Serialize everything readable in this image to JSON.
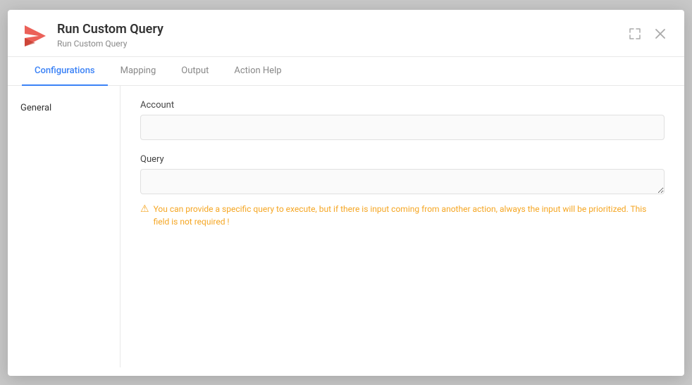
{
  "modal": {
    "title": "Run Custom Query",
    "subtitle": "Run Custom Query",
    "tabs": [
      {
        "label": "Configurations",
        "active": true
      },
      {
        "label": "Mapping",
        "active": false
      },
      {
        "label": "Output",
        "active": false
      },
      {
        "label": "Action Help",
        "active": false
      }
    ],
    "sidebar": {
      "items": [
        {
          "label": "General"
        }
      ]
    },
    "fields": {
      "account": {
        "label": "Account",
        "placeholder": "",
        "value": ""
      },
      "query": {
        "label": "Query",
        "placeholder": "",
        "value": "",
        "hint": "You can provide a specific query to execute, but if there is input coming from another action, always the input will be prioritized. This field is not required !"
      }
    },
    "controls": {
      "expand_label": "⤢",
      "close_label": "✕"
    }
  }
}
